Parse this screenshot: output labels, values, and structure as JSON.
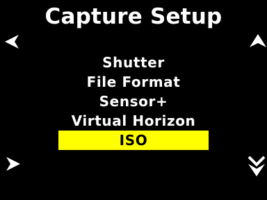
{
  "screen": {
    "title": "Capture Setup"
  },
  "menu": {
    "items": [
      {
        "label": "Shutter"
      },
      {
        "label": "File Format"
      },
      {
        "label": "Sensor+"
      },
      {
        "label": "Virtual Horizon"
      },
      {
        "label": "ISO"
      }
    ],
    "selected_index": 4
  },
  "icons": {
    "left": "chevron-left-icon",
    "right": "chevron-right-icon",
    "up": "chevron-up-icon",
    "down": "double-chevron-down-icon"
  },
  "colors": {
    "background": "#000000",
    "text": "#ffffff",
    "highlight": "#ffff00",
    "highlight_text": "#000000"
  }
}
